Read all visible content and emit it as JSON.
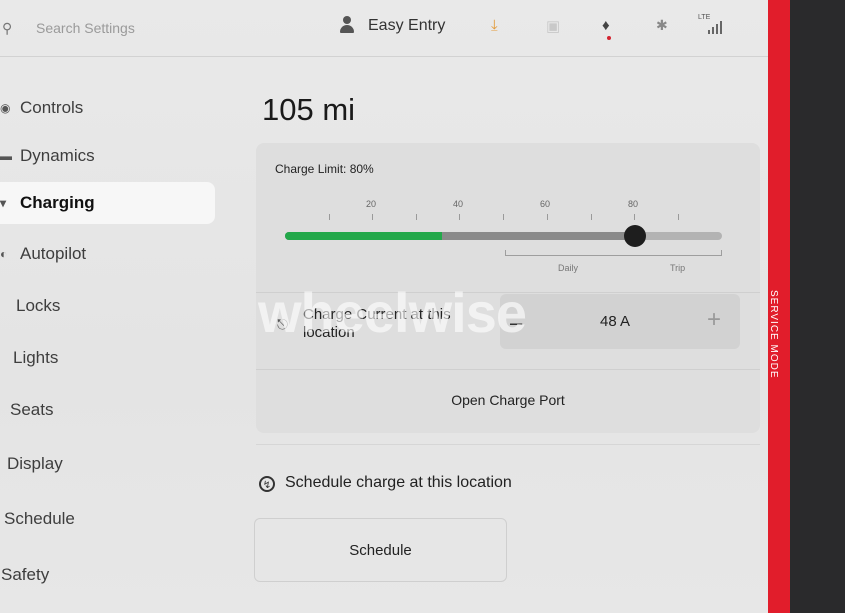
{
  "topbar": {
    "search_placeholder": "Search Settings",
    "profile_name": "Easy Entry",
    "status_icons": [
      "download-icon",
      "lock-icon",
      "bell-icon",
      "bluetooth-icon",
      "lte-signal-icon"
    ],
    "lte_label": "LTE"
  },
  "sidebar": {
    "items": [
      {
        "label": "Controls",
        "icon": "toggle-icon"
      },
      {
        "label": "Dynamics",
        "icon": "car-icon"
      },
      {
        "label": "Charging",
        "icon": "bolt-icon",
        "active": true
      },
      {
        "label": "Autopilot",
        "icon": "steering-wheel-icon"
      },
      {
        "label": "Locks"
      },
      {
        "label": "Lights"
      },
      {
        "label": "Seats"
      },
      {
        "label": "Display"
      },
      {
        "label": "Schedule"
      },
      {
        "label": "Safety"
      }
    ]
  },
  "main": {
    "range": "105 mi",
    "charge_limit_label": "Charge Limit: 80%",
    "charge_limit_value": 80,
    "current_charge_percent": 36,
    "slider_ticks": [
      "20",
      "40",
      "60",
      "80"
    ],
    "zone_labels": [
      "Daily",
      "Trip"
    ],
    "charge_current_label": "Charge Current at this location",
    "charge_current_value": "48 A",
    "minus_symbol": "–",
    "plus_symbol": "+",
    "open_charge_port": "Open Charge Port",
    "schedule_label": "Schedule charge at this location",
    "schedule_button": "Schedule"
  },
  "service_mode_label": "SERVICE MODE",
  "watermark": "wheelwise",
  "colors": {
    "charge_fill": "#23a84a",
    "service_bar": "#e11d2b",
    "download_icon": "#e39a3a",
    "notification_dot": "#d3232f"
  }
}
